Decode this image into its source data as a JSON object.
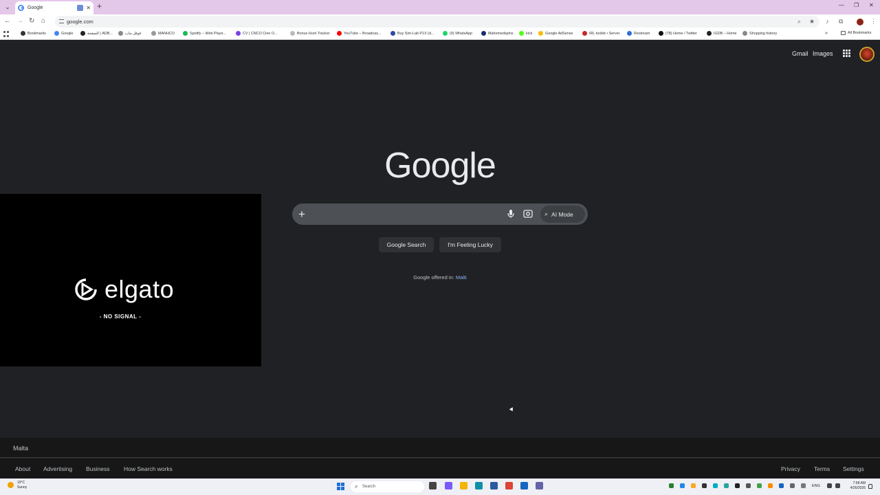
{
  "browser": {
    "tab_title": "Google",
    "address": "google.com",
    "new_tab_glyph": "+",
    "tab_close_glyph": "✕",
    "window_controls": [
      "—",
      "❐",
      "✕"
    ],
    "nav_glyphs": {
      "back": "←",
      "forward": "→",
      "reload": "↻",
      "home": "⌂"
    },
    "toolbar_icons": [
      "zoom-icon",
      "star-icon",
      "media-icon",
      "extensions-icon",
      "profile-icon",
      "menu-icon"
    ],
    "bookmarks": [
      {
        "label": "Bookmarks",
        "color": "#333333"
      },
      {
        "label": "Google",
        "color": "#4285f4"
      },
      {
        "label": "الصفحة | ADB...",
        "color": "#222222"
      },
      {
        "label": "قوقل ماب",
        "color": "#888888"
      },
      {
        "label": "MANHCO",
        "color": "#999999"
      },
      {
        "label": "Spotify – Web Playe...",
        "color": "#1db954"
      },
      {
        "label": "CV | CNCO Cine O...",
        "color": "#7b3fe4"
      },
      {
        "label": "Bonus Hunt Tracker",
        "color": "#bbbbbb"
      },
      {
        "label": "YouTube – Broadcas...",
        "color": "#ff0000"
      },
      {
        "label": "Buy Sim-Lab P1X (d...",
        "color": "#2a4aa0"
      },
      {
        "label": "(9) WhatsApp",
        "color": "#25d366"
      },
      {
        "label": "Mahomedspins",
        "color": "#1a2a6c"
      },
      {
        "label": "kick",
        "color": "#53fc18"
      },
      {
        "label": "Google AdSense",
        "color": "#fbbc04"
      },
      {
        "label": "IRL toolkit • Server",
        "color": "#c62828"
      },
      {
        "label": "Restream",
        "color": "#2b6fd6"
      },
      {
        "label": "(78) Home / Twitter",
        "color": "#111111"
      },
      {
        "label": "IGDB – Home",
        "color": "#222222"
      },
      {
        "label": "Shopping history",
        "color": "#888888"
      }
    ],
    "bookmarks_overflow": "»",
    "all_bookmarks": "All Bookmarks"
  },
  "google": {
    "header_links": {
      "gmail": "Gmail",
      "images": "Images"
    },
    "logo": "Google",
    "plus_glyph": "+",
    "ai_mode": "AI Mode",
    "ai_mode_glyph": "⌕",
    "buttons": {
      "search": "Google Search",
      "lucky": "I'm Feeling Lucky"
    },
    "offered_in": "Google offered in:",
    "offered_lang": "Malti"
  },
  "overlay": {
    "brand": "elgato",
    "status": "- NO SIGNAL -"
  },
  "footer": {
    "country": "Malta",
    "left_links": [
      "About",
      "Advertising",
      "Business",
      "How Search works"
    ],
    "right_links": [
      "Privacy",
      "Terms",
      "Settings"
    ]
  },
  "taskbar": {
    "weather_temp": "19°C",
    "weather_desc": "Sunny",
    "search_placeholder": "Search",
    "search_glyph": "⌕",
    "language": "ENG",
    "time": "7:58 AM",
    "date": "4/26/2026",
    "apps": [
      {
        "name": "task-view-icon",
        "color": "#444444"
      },
      {
        "name": "copilot-icon",
        "color": "#7a5af8"
      },
      {
        "name": "file-explorer-icon",
        "color": "#f4b400"
      },
      {
        "name": "edge-icon",
        "color": "#0f8fa8"
      },
      {
        "name": "store-icon",
        "color": "#2c5aa0"
      },
      {
        "name": "chrome-icon",
        "color": "#db4437"
      },
      {
        "name": "app-icon",
        "color": "#1565c0"
      },
      {
        "name": "teams-icon",
        "color": "#6264a7"
      }
    ]
  },
  "colors": {
    "page_bg": "#202124",
    "tabstrip_bg": "#e3c8ea",
    "link_blue": "#8ab4f8",
    "searchbar_bg": "#4d5156"
  }
}
